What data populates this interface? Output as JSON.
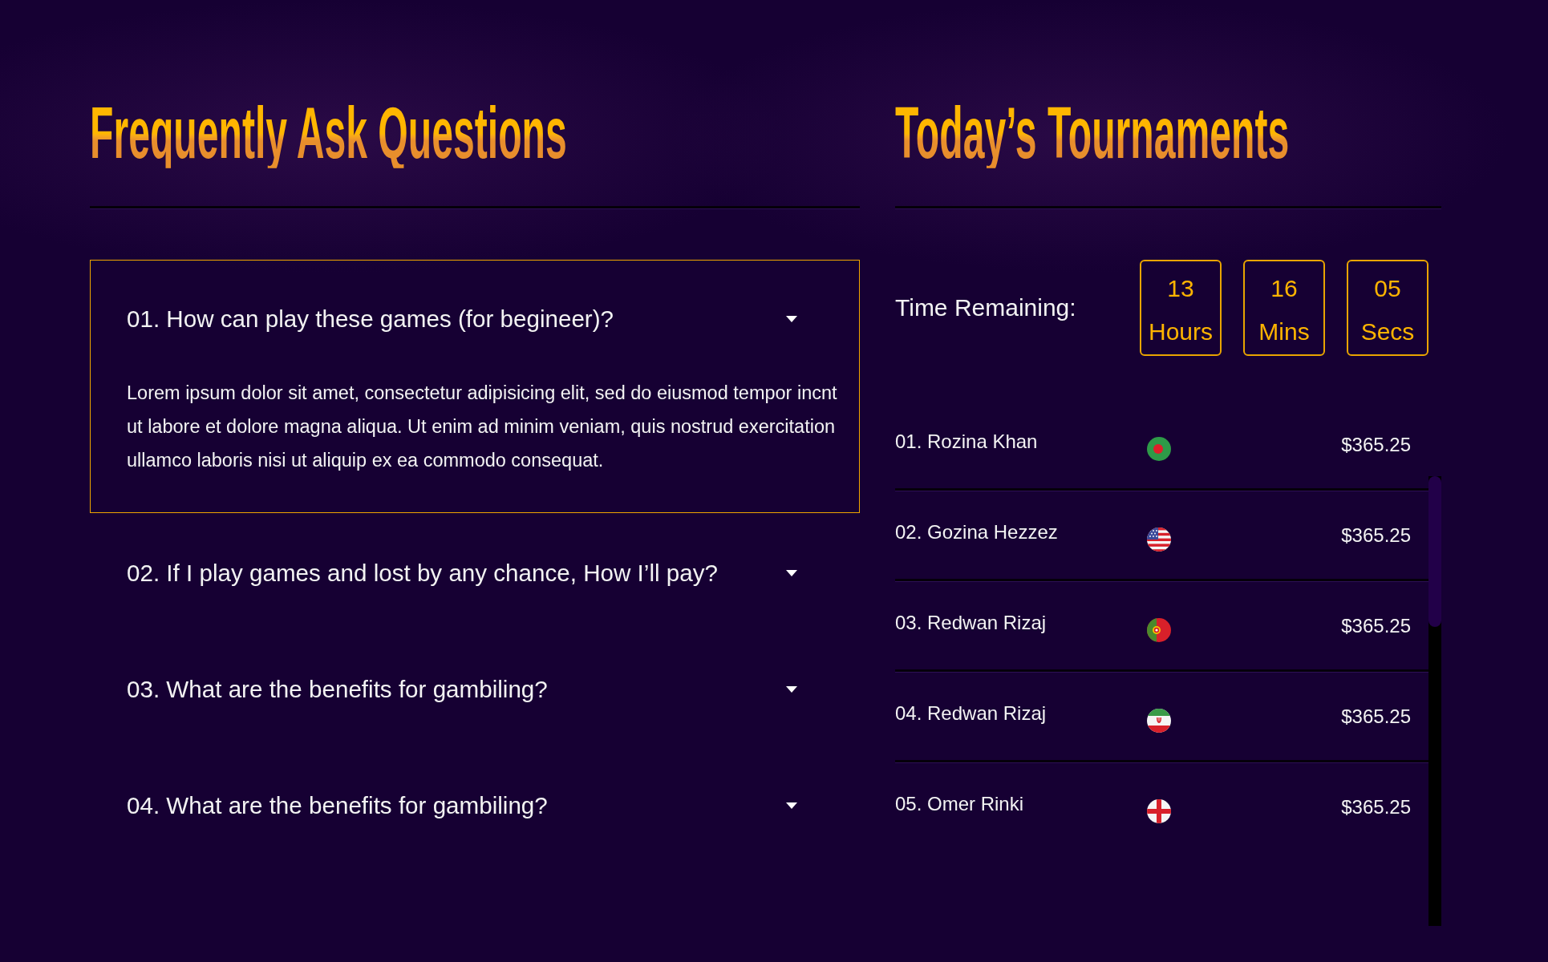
{
  "faq": {
    "title": "Frequently Ask Questions",
    "items": [
      {
        "question": "01. How can play these games (for begineer)?",
        "expanded": true,
        "answer": "Lorem ipsum dolor sit amet, consectetur adipisicing elit, sed do eiusmod tempor incnt ut labore et dolore magna aliqua. Ut enim ad minim veniam, quis nostrud exercitation ullamco laboris nisi ut aliquip ex ea commodo consequat."
      },
      {
        "question": "02. If I play games and lost by any chance, How I’ll pay?",
        "expanded": false
      },
      {
        "question": "03. What are the benefits for gambiling?",
        "expanded": false
      },
      {
        "question": "04. What are the benefits for gambiling?",
        "expanded": false
      }
    ]
  },
  "tournaments": {
    "title": "Today’s Tournaments",
    "timer": {
      "label": "Time Remaining:",
      "units": [
        {
          "value": "13",
          "unit": "Hours"
        },
        {
          "value": "16",
          "unit": "Mins"
        },
        {
          "value": "05",
          "unit": "Secs"
        }
      ]
    },
    "players": [
      {
        "name": "01. Rozina Khan",
        "kind": "bangladesh",
        "amount": "$365.25"
      },
      {
        "name": "02. Gozina Hezzez",
        "kind": "usa",
        "amount": "$365.25"
      },
      {
        "name": "03. Redwan Rizaj",
        "kind": "portugal",
        "amount": "$365.25"
      },
      {
        "name": "04. Redwan Rizaj",
        "kind": "iran",
        "amount": "$365.25"
      },
      {
        "name": "05. Omer Rinki",
        "kind": "england",
        "amount": "$365.25"
      }
    ]
  }
}
